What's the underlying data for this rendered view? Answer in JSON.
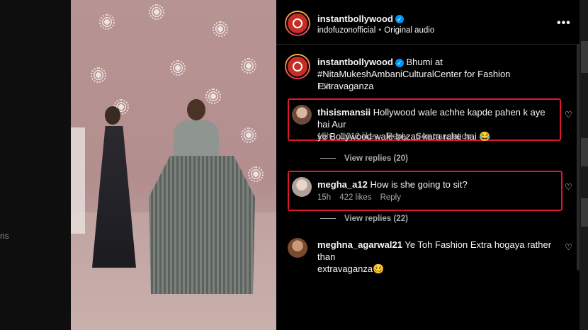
{
  "backdrop": {
    "left_text": "ns"
  },
  "post": {
    "author": "instantbollywood",
    "audio_user": "indofuzonofficial",
    "audio_label": "Original audio",
    "caption_author": "instantbollywood",
    "caption_line1": "Bhumi at",
    "caption_line2": "#NitaMukeshAmbaniCulturalCenter for Fashion Extravaganza",
    "caption_time": "15h"
  },
  "comments": [
    {
      "user": "thisismansii",
      "text_line1": "Hollywood wale achhe kapde pahen k aye hai Aur",
      "text_line2": "ye Bollywood wale bezati kara rahe hai 😂",
      "time": "15h",
      "likes": "1,012 likes",
      "reply": "Reply",
      "translation": "See translation",
      "view_replies": "View replies (20)"
    },
    {
      "user": "megha_a12",
      "text_line1": "How is she going to sit?",
      "time": "15h",
      "likes": "422 likes",
      "reply": "Reply",
      "view_replies": "View replies (22)"
    },
    {
      "user": "meghna_agarwal21",
      "text_line1": "Ye Toh Fashion Extra hogaya rather than",
      "text_line2": "extravaganza🥴"
    }
  ],
  "icons": {
    "more": "more-options-icon",
    "heart": "heart-icon",
    "verified": "verified-badge-icon"
  },
  "colors": {
    "panel_bg": "#000000",
    "text": "#f5f5f5",
    "muted": "#a8a8a8",
    "highlight": "#e0182a",
    "verified": "#0095f6"
  }
}
